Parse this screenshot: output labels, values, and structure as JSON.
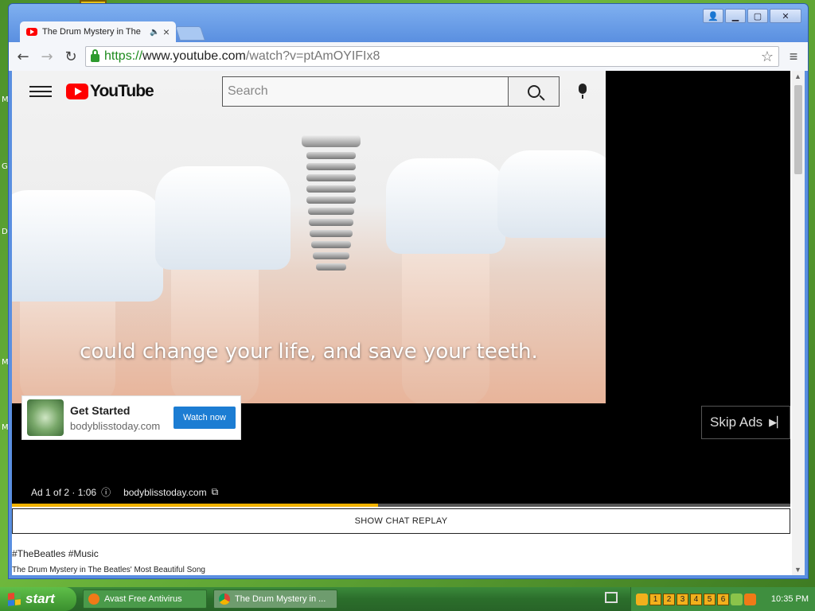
{
  "browser": {
    "tab_title": "The Drum Mystery in The",
    "tab_audio_icon": "speaker-icon",
    "tab_close": "×",
    "url_scheme": "https://",
    "url_host": "www.youtube.com",
    "url_path": "/watch?v=ptAmOYIFIx8",
    "back": "←",
    "forward": "→",
    "reload": "↻",
    "star": "☆",
    "menu": "≡",
    "window_buttons": {
      "user": "👤",
      "minimize": "▁",
      "maximize": "▢",
      "close": "✕"
    }
  },
  "youtube": {
    "logo_text": "YouTube",
    "search_placeholder": "Search",
    "video_caption": "could change your life, and save your teeth.",
    "ad_card": {
      "title": "Get Started",
      "domain": "bodyblisstoday.com",
      "button": "Watch now"
    },
    "skip_label": "Skip Ads",
    "skip_icon": "▶▏",
    "ad_info": "Ad 1 of 2 · 1:06",
    "ad_info_icon": "ⓘ",
    "ad_link": "bodyblisstoday.com",
    "ad_link_icon": "⧉",
    "ad_progress": 0.47,
    "chat_replay": "SHOW CHAT REPLAY",
    "hashtags": "#TheBeatles #Music",
    "video_title": "The Drum Mystery in The Beatles' Most Beautiful Song"
  },
  "taskbar": {
    "start": "start",
    "tasks": [
      {
        "label": "Avast Free Antivirus"
      },
      {
        "label": "The Drum Mystery in ..."
      }
    ],
    "tray_numbers": [
      "1",
      "2",
      "3",
      "4",
      "5",
      "6"
    ],
    "clock": "10:35 PM"
  },
  "colors": {
    "youtube_red": "#ff0000",
    "watch_button": "#1c7dd3",
    "progress": "#f4b400",
    "taskbar": "#2b6e2b"
  }
}
